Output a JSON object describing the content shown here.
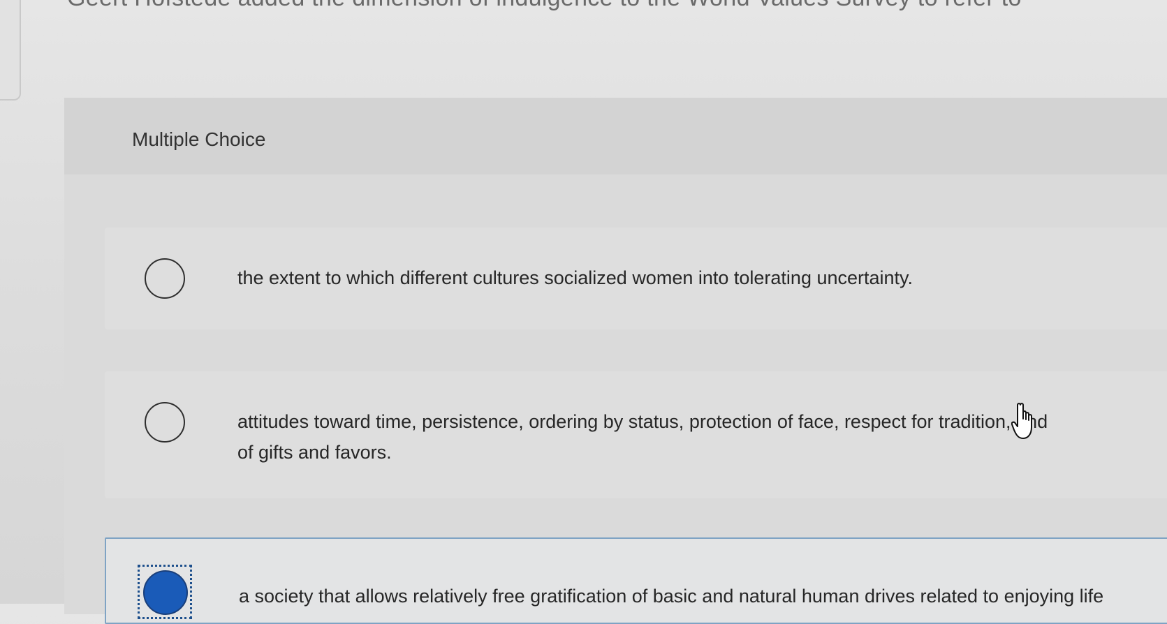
{
  "question": {
    "text": "Geert Hofstede added the dimension of indulgence to the World Values Survey to refer to"
  },
  "panel": {
    "title": "Multiple Choice"
  },
  "choices": [
    {
      "lines": [
        "the extent to which different cultures socialized women into tolerating uncertainty."
      ],
      "selected": false
    },
    {
      "lines": [
        "attitudes toward time, persistence, ordering by status, protection of face, respect for tradition, and",
        "of gifts and favors."
      ],
      "selected": false
    },
    {
      "lines": [
        "a society that allows relatively free gratification of basic and natural human drives related to enjoying life"
      ],
      "selected": true
    }
  ],
  "colors": {
    "selected_radio": "#1a5bb8",
    "focus_ring": "#1d4f8c",
    "selected_border": "#7fa3c4"
  },
  "icons": {
    "cursor": "hand-pointer-icon"
  }
}
